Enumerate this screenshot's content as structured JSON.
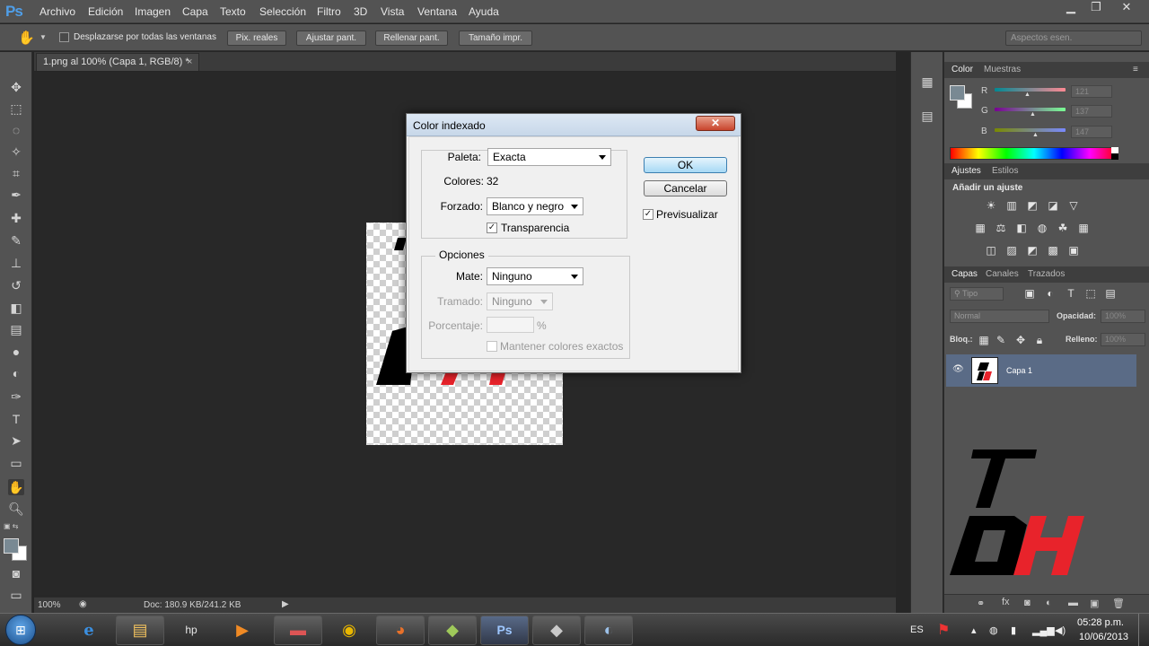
{
  "app": {
    "logo": "Ps"
  },
  "menu": [
    "Archivo",
    "Edición",
    "Imagen",
    "Capa",
    "Texto",
    "Selección",
    "Filtro",
    "3D",
    "Vista",
    "Ventana",
    "Ayuda"
  ],
  "window_controls": [
    "minimize-icon",
    "restore-icon",
    "close-icon"
  ],
  "options_bar": {
    "tool_icon": "hand-icon",
    "scroll_all_label": "Desplazarse por todas las ventanas",
    "buttons": [
      "Pix. reales",
      "Ajustar pant.",
      "Rellenar pant.",
      "Tamaño impr."
    ],
    "workspace": "Aspectos esen."
  },
  "document": {
    "tab_title": "1.png al 100% (Capa 1, RGB/8) *",
    "tab_close": "×"
  },
  "status_bar": {
    "zoom": "100%",
    "doc_info": "Doc: 180.9 KB/241.2 KB"
  },
  "color_panel": {
    "tabs": [
      "Color",
      "Muestras"
    ],
    "channels": [
      {
        "label": "R",
        "value": "121"
      },
      {
        "label": "G",
        "value": "137"
      },
      {
        "label": "B",
        "value": "147"
      }
    ],
    "foreground_color": "#798993"
  },
  "adjustments_panel": {
    "tabs": [
      "Ajustes",
      "Estilos"
    ],
    "heading": "Añadir un ajuste"
  },
  "layers_panel": {
    "tabs": [
      "Capas",
      "Canales",
      "Trazados"
    ],
    "filter": "Tipo",
    "blend_mode": "Normal",
    "opacity_label": "Opacidad:",
    "opacity": "100%",
    "lock_label": "Bloq.:",
    "fill_label": "Relleno:",
    "fill": "100%",
    "layers": [
      {
        "name": "Capa 1"
      }
    ]
  },
  "dialog": {
    "title": "Color indexado",
    "close": "✕",
    "palette_label": "Paleta:",
    "palette": "Exacta",
    "colors_label": "Colores:",
    "colors": "32",
    "forced_label": "Forzado:",
    "forced": "Blanco y negro",
    "transparency_label": "Transparencia",
    "transparency_checked": true,
    "options_legend": "Opciones",
    "matte_label": "Mate:",
    "matte": "Ninguno",
    "dither_label": "Tramado:",
    "dither": "Ninguno",
    "amount_label": "Porcentaje:",
    "amount_unit": "%",
    "preserve_exact_label": "Mantener colores exactos",
    "ok": "OK",
    "cancel": "Cancelar",
    "preview_label": "Previsualizar",
    "preview_checked": true
  },
  "taskbar": {
    "apps": [
      "start-orb-icon",
      "internet-explorer-icon",
      "file-explorer-icon",
      "hp-icon",
      "media-player-icon",
      "scanner-app-icon",
      "chrome-icon",
      "firefox-icon",
      "app-icon",
      "photoshop-icon",
      "app2-icon",
      "paint-icon"
    ],
    "tray": {
      "language": "ES",
      "time": "05:28 p.m.",
      "date": "10/06/2013"
    }
  },
  "colors": {
    "accent_red": "#e8232b",
    "ps_blue": "#4f9ee8",
    "panel_bg": "#535353"
  }
}
